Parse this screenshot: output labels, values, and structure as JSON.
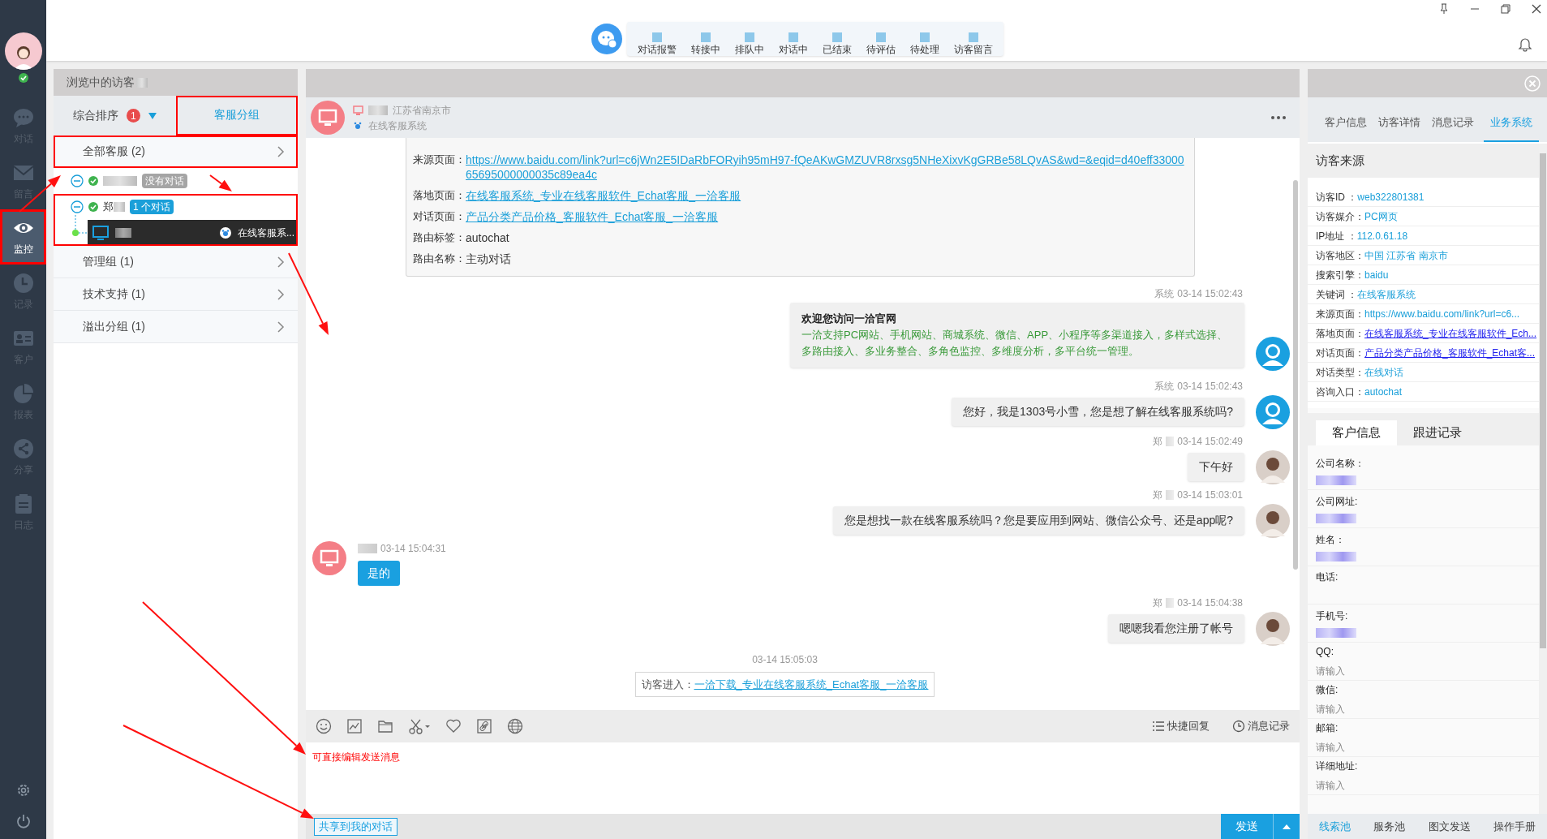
{
  "sidebar": {
    "items": [
      {
        "kind": "chat",
        "label": "对话",
        "selected": false,
        "annotated": false
      },
      {
        "kind": "mail",
        "label": "留言",
        "selected": false,
        "annotated": false
      },
      {
        "kind": "eye",
        "label": "监控",
        "selected": true,
        "annotated": true
      },
      {
        "kind": "clock",
        "label": "记录",
        "selected": false,
        "annotated": false
      },
      {
        "kind": "card",
        "label": "客户",
        "selected": false,
        "annotated": false
      },
      {
        "kind": "pie",
        "label": "报表",
        "selected": false,
        "annotated": false
      },
      {
        "kind": "share",
        "label": "分享",
        "selected": false,
        "annotated": false
      },
      {
        "kind": "clipboard",
        "label": "日志",
        "selected": false,
        "annotated": false
      }
    ]
  },
  "toolbar": {
    "items": [
      {
        "label": "对话报警"
      },
      {
        "label": "转接中"
      },
      {
        "label": "排队中"
      },
      {
        "label": "对话中"
      },
      {
        "label": "已结束"
      },
      {
        "label": "待评估"
      },
      {
        "label": "待处理"
      },
      {
        "label": "访客留言"
      }
    ]
  },
  "visitor_panel": {
    "title": "浏览中的访客",
    "tabs": [
      {
        "label": "综合排序",
        "badge": "1",
        "selected": false,
        "annotated": false
      },
      {
        "label": "客服分组",
        "selected": true,
        "annotated": true
      }
    ],
    "groups": [
      {
        "label": "全部客服 (2)",
        "annotated": true,
        "agents": [
          {
            "status_badge": "没有对话",
            "busy": false,
            "annotated": false
          },
          {
            "name": "郑",
            "status_badge": "1 个对话",
            "busy": true,
            "annotated": true,
            "visitors": [
              {
                "source": "在线客服系..."
              }
            ]
          }
        ]
      },
      {
        "label": "管理组 (1)",
        "annotated": false
      },
      {
        "label": "技术支持 (1)",
        "annotated": false
      },
      {
        "label": "溢出分组 (1)",
        "annotated": false
      }
    ]
  },
  "chat": {
    "header": {
      "location": "江苏省南京市",
      "source": "在线客服系统"
    },
    "info_rows": [
      {
        "label": "来源页面：",
        "value": "https://www.baidu.com/link?url=c6jWn2E5IDaRbFORyih95mH97-fQeAKwGMZUVR8rxsg5NHeXixvKgGRBe58LQvAS&wd=&eqid=d40eff3300065695000000035c89ea4c",
        "kind": "link"
      },
      {
        "label": "落地页面：",
        "value": "在线客服系统_专业在线客服软件_Echat客服_一洽客服",
        "kind": "link"
      },
      {
        "label": "对话页面：",
        "value": "产品分类产品价格_客服软件_Echat客服_一洽客服",
        "kind": "link"
      },
      {
        "label": "路由标签：",
        "value": "autochat",
        "kind": "text"
      },
      {
        "label": "路由名称：",
        "value": "主动对话",
        "kind": "text"
      }
    ],
    "messages": [
      {
        "kind": "bot",
        "sender": "系统",
        "time": "03-14 15:02:43",
        "title": "欢迎您访问一洽官网",
        "text": "一洽支持PC网站、手机网站、商城系统、微信、APP、小程序等多渠道接入，多样式选择、多路由接入、多业务整合、多角色监控、多维度分析，多平台统一管理。"
      },
      {
        "kind": "bot",
        "sender": "系统",
        "time": "03-14 15:02:43",
        "text": "您好，我是1303号小雪，您是想了解在线客服系统吗?"
      },
      {
        "kind": "agent",
        "sender": "郑",
        "time": "03-14 15:02:49",
        "text": "下午好"
      },
      {
        "kind": "agent",
        "sender": "郑",
        "time": "03-14 15:03:01",
        "text": "您是想找一款在线客服系统吗？您是要应用到网站、微信公众号、还是app呢?"
      },
      {
        "kind": "visitor",
        "time": "03-14 15:04:31",
        "text": "是的"
      },
      {
        "kind": "agent",
        "sender": "郑",
        "time": "03-14 15:04:38",
        "text": "嗯嗯我看您注册了帐号"
      },
      {
        "kind": "notice",
        "time": "03-14 15:05:03",
        "label": "访客进入：",
        "link": "一洽下载_专业在线客服系统_Echat客服_一洽客服"
      }
    ],
    "toolbar_buttons": [
      {
        "kind": "list",
        "label": "快捷回复"
      },
      {
        "kind": "clock",
        "label": "消息记录"
      }
    ],
    "input_annotation": "可直接编辑发送消息",
    "share_button": "共享到我的对话",
    "send_button": "发送"
  },
  "info_panel": {
    "tabs": [
      {
        "label": "客户信息",
        "selected": false
      },
      {
        "label": "访客详情",
        "selected": false
      },
      {
        "label": "消息记录",
        "selected": false
      },
      {
        "label": "业务系统",
        "selected": true
      }
    ],
    "section_title": "访客来源",
    "fields": [
      {
        "label": "访客ID ：",
        "value": "web322801381",
        "kind": "text"
      },
      {
        "label": "访客媒介：",
        "value": "PC网页",
        "kind": "text"
      },
      {
        "label": "IP地址 ：",
        "value": "112.0.61.18",
        "kind": "text"
      },
      {
        "label": "访客地区：",
        "value": "中国 江苏省 南京市",
        "kind": "text"
      },
      {
        "label": "搜索引擎：",
        "value": "baidu",
        "kind": "text"
      },
      {
        "label": "关键词 ：",
        "value": "在线客服系统",
        "kind": "text"
      },
      {
        "label": "来源页面：",
        "value": "https://www.baidu.com/link?url=c6...",
        "kind": "text"
      },
      {
        "label": "落地页面：",
        "value": "在线客服系统_专业在线客服软件_Ech...",
        "kind": "link"
      },
      {
        "label": "对话页面：",
        "value": "产品分类产品价格_客服软件_Echat客...",
        "kind": "link"
      },
      {
        "label": "对话类型：",
        "value": "在线对话",
        "kind": "text"
      },
      {
        "label": "咨询入口：",
        "value": "autochat",
        "kind": "text"
      }
    ],
    "sub_tabs": [
      {
        "label": "客户信息",
        "selected": true
      },
      {
        "label": "跟进记录",
        "selected": false
      }
    ],
    "customer_fields": [
      {
        "label": "公司名称：",
        "kind": "redacted"
      },
      {
        "label": "公司网址:",
        "kind": "redacted"
      },
      {
        "label": "姓名：",
        "kind": "redacted"
      },
      {
        "label": "电话:",
        "kind": "empty"
      },
      {
        "label": "手机号:",
        "kind": "redacted"
      },
      {
        "label": "QQ:",
        "kind": "input",
        "placeholder": "请输入"
      },
      {
        "label": "微信:",
        "kind": "input",
        "placeholder": "请输入"
      },
      {
        "label": "邮箱:",
        "kind": "input",
        "placeholder": "请输入"
      },
      {
        "label": "详细地址:",
        "kind": "input",
        "placeholder": "请输入"
      }
    ],
    "bottom_tabs": [
      {
        "label": "线索池",
        "selected": true
      },
      {
        "label": "服务池",
        "selected": false
      },
      {
        "label": "图文发送",
        "selected": false
      },
      {
        "label": "操作手册",
        "selected": false
      }
    ]
  }
}
